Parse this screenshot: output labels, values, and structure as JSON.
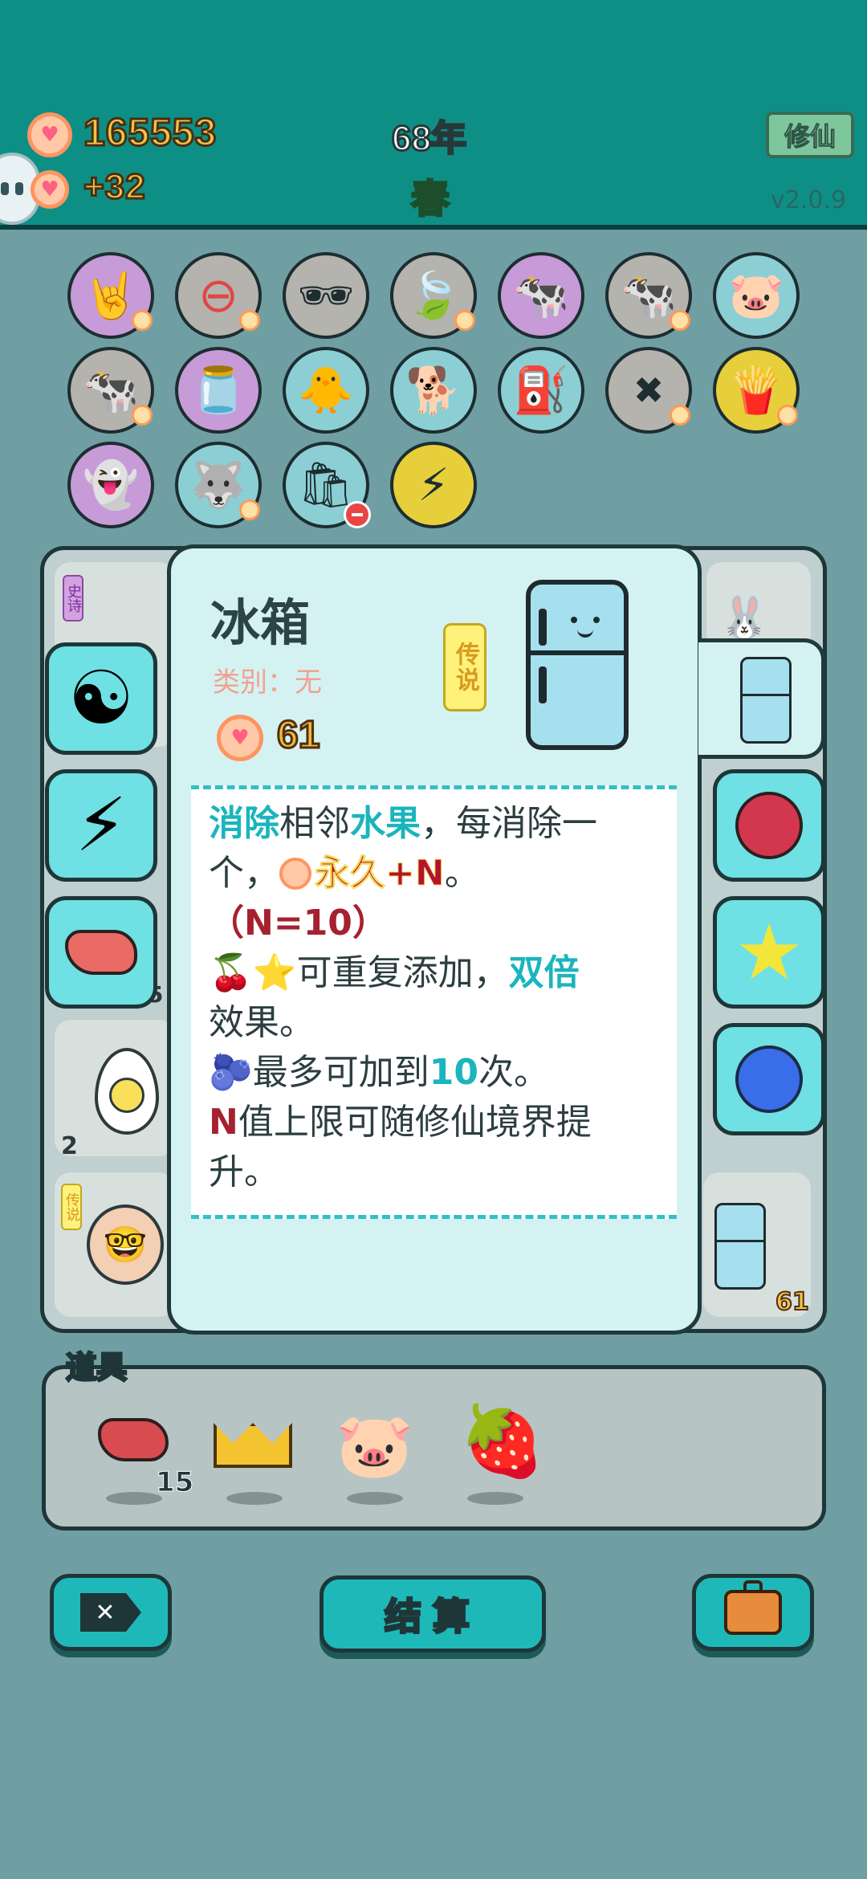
{
  "header": {
    "coins": "165553",
    "coin_gain": "+32",
    "year": "68年",
    "season": "春",
    "xiuxian_button": "修仙",
    "version": "v2.0.9"
  },
  "relics": [
    {
      "name": "rock-hand",
      "icon": "🤘",
      "bg": "purple"
    },
    {
      "name": "no-entry",
      "icon": "⊖",
      "bg": "gray"
    },
    {
      "name": "eyepatch-fruit",
      "icon": "🏴‍☠️",
      "bg": "gray"
    },
    {
      "name": "leaf",
      "icon": "🍃",
      "bg": "gray"
    },
    {
      "name": "cow-pair",
      "icon": "🐄",
      "bg": "purple"
    },
    {
      "name": "cow-pair-2",
      "icon": "🐄",
      "bg": "gray"
    },
    {
      "name": "piggy-bank",
      "icon": "🐷",
      "bg": "teal"
    },
    {
      "name": "cow-pair-3",
      "icon": "🐄",
      "bg": "gray"
    },
    {
      "name": "yogurt-jar",
      "icon": "🫙",
      "bg": "purple"
    },
    {
      "name": "chick-egg",
      "icon": "🐥",
      "bg": "teal"
    },
    {
      "name": "cool-dog",
      "icon": "🐕",
      "bg": "teal"
    },
    {
      "name": "pump",
      "icon": "⛽",
      "bg": "teal"
    },
    {
      "name": "delete-tag",
      "icon": "✖",
      "bg": "gray"
    },
    {
      "name": "fries",
      "icon": "🍟",
      "bg": "yellow"
    },
    {
      "name": "ghost-speaker",
      "icon": "👻",
      "bg": "purple"
    },
    {
      "name": "husky",
      "icon": "🐺",
      "bg": "teal"
    },
    {
      "name": "trash-bag",
      "icon": "🛍",
      "bg": "teal"
    },
    {
      "name": "lightning",
      "icon": "⚡",
      "bg": "yellow"
    }
  ],
  "board": {
    "tag_epic": "史诗",
    "tag_legend": "传说",
    "count_egg": "2",
    "count_fridge": "61",
    "count_partial": "5"
  },
  "modal": {
    "title": "冰箱",
    "category": "类别：无",
    "price": "61",
    "rarity": "传说",
    "desc": {
      "l1_a": "消除",
      "l1_b": "相邻",
      "l1_c": "水果",
      "l1_d": "，每消除一",
      "l2_a": "个，",
      "l2_b": "永久+N",
      "l2_c": "。",
      "l3": "（N=10）",
      "l4_a": "可重复添加，",
      "l4_b": "双倍",
      "l5": "效果。",
      "l6_a": "最多可加到",
      "l6_b": "10",
      "l6_c": "次。",
      "l7_a": "N",
      "l7_b": "值上限可随修仙境界提",
      "l8": "升。"
    }
  },
  "props": {
    "label": "道具",
    "liver_count": "15"
  },
  "buttons": {
    "settle": "结算"
  },
  "colors": {
    "header": "#0e8f86",
    "accent_teal": "#1ab5bd",
    "coin_text": "#f2c34a"
  }
}
